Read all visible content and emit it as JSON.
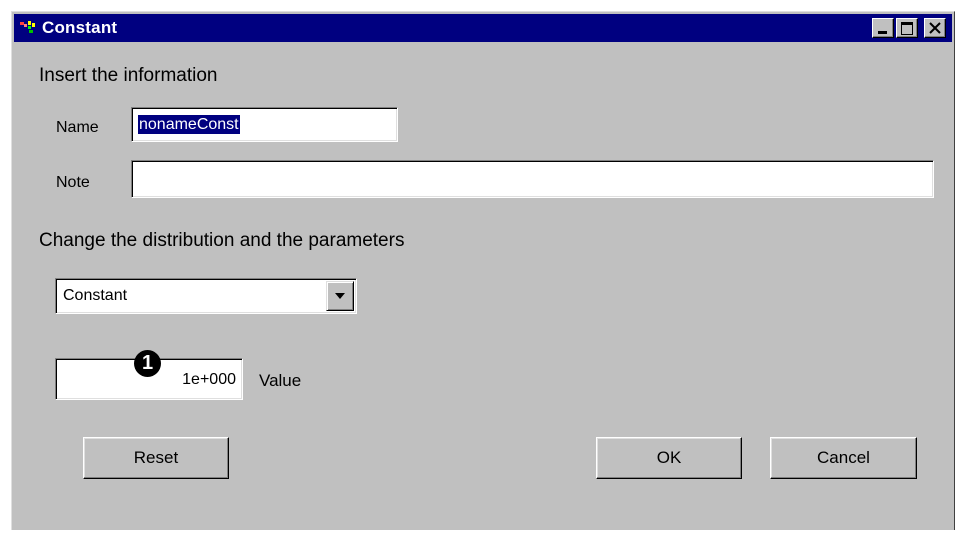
{
  "window": {
    "title": "Constant",
    "icon": "app-icon",
    "controls": [
      "minimize-icon",
      "maximize-icon",
      "close-icon"
    ]
  },
  "info_section": {
    "heading": "Insert the information",
    "name_label": "Name",
    "name_value": "nonameConst",
    "note_label": "Note",
    "note_value": ""
  },
  "distribution_section": {
    "heading": "Change the distribution and the parameters",
    "selected_distribution": "Constant",
    "value_field": "1e+000",
    "value_label": "Value",
    "callout_marker": "1"
  },
  "buttons": {
    "reset": "Reset",
    "ok": "OK",
    "cancel": "Cancel"
  },
  "colors": {
    "titlebar": "#000080",
    "face": "#c0c0c0",
    "selection": "#000080"
  }
}
